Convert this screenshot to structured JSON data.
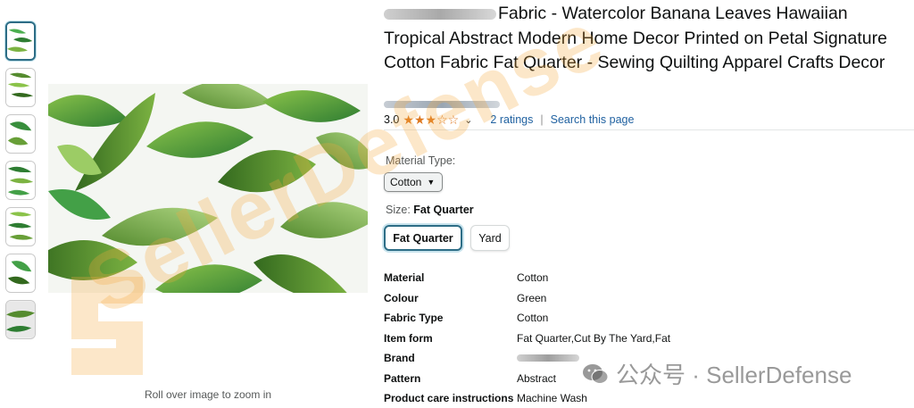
{
  "product": {
    "title": "Fabric - Watercolor Banana Leaves Hawaiian Tropical Abstract Modern Home Decor Printed on Petal Signature Cotton Fabric Fat Quarter - Sewing Quilting Apparel Crafts Decor"
  },
  "rating": {
    "value": "3.0",
    "stars_filled": 3,
    "stars_total": 5,
    "ratings_link": "2 ratings",
    "separator": "|",
    "search_link": "Search this page"
  },
  "material_type": {
    "label": "Material Type:",
    "selected": "Cotton"
  },
  "size": {
    "label": "Size: ",
    "value": "Fat Quarter",
    "options": [
      "Fat Quarter",
      "Yard"
    ]
  },
  "attributes": [
    {
      "key": "Material",
      "value": "Cotton"
    },
    {
      "key": "Colour",
      "value": "Green"
    },
    {
      "key": "Fabric Type",
      "value": "Cotton"
    },
    {
      "key": "Item form",
      "value": "Fat Quarter,Cut By The Yard,Fat"
    },
    {
      "key": "Brand",
      "value": ""
    },
    {
      "key": "Pattern",
      "value": "Abstract"
    },
    {
      "key": "Product care instructions",
      "value": "Machine Wash"
    }
  ],
  "image": {
    "zoom_hint": "Roll over image to zoom in"
  },
  "watermark": {
    "text": "SellerDefense",
    "wechat": "公众号 · SellerDefense"
  },
  "colors": {
    "link": "#2162a1",
    "star": "#de7921",
    "selected_border": "#2d6d86",
    "leaf_dark": "#2e7d32",
    "leaf_light": "#8bc34a"
  }
}
